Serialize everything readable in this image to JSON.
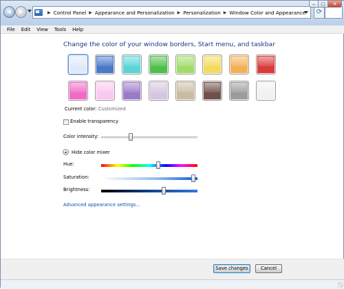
{
  "window": {
    "breadcrumbs": [
      "Control Panel",
      "Appearance and Personalization",
      "Personalization",
      "Window Color and Appearance"
    ],
    "controls": {
      "min": "‒",
      "max": "▢",
      "close": "✕"
    }
  },
  "menu": [
    "File",
    "Edit",
    "View",
    "Tools",
    "Help"
  ],
  "heading": "Change the color of your window borders, Start menu, and taskbar",
  "swatches": [
    {
      "color": "#dfe9f9",
      "selected": true
    },
    {
      "color": "#4a78c8"
    },
    {
      "color": "#5bd4d8"
    },
    {
      "color": "#4fbe4a"
    },
    {
      "color": "#a0dc6a"
    },
    {
      "color": "#f3db5c"
    },
    {
      "color": "#f3b157"
    },
    {
      "color": "#dc3b3b"
    },
    {
      "color": "#f06ac6"
    },
    {
      "color": "#f9c8ef"
    },
    {
      "color": "#9b7bc8"
    },
    {
      "color": "#d6c5df"
    },
    {
      "color": "#c9bca2"
    },
    {
      "color": "#6e5148"
    },
    {
      "color": "#9c9c9c"
    },
    {
      "color": "#f1f1f1"
    }
  ],
  "current_color_label": "Current color:",
  "current_color_value": "Customized",
  "transparency": {
    "label": "Enable transparency",
    "checked": false
  },
  "intensity": {
    "label": "Color intensity:",
    "value": 0.3
  },
  "color_mixer": {
    "toggle_label": "Hide color mixer",
    "hue": {
      "label": "Hue:",
      "value": 0.6
    },
    "saturation": {
      "label": "Saturation:",
      "value": 0.98
    },
    "brightness": {
      "label": "Brightness:",
      "value": 0.66
    }
  },
  "advanced_link": "Advanced appearance settings...",
  "buttons": {
    "save": "Save changes",
    "cancel": "Cancel"
  }
}
